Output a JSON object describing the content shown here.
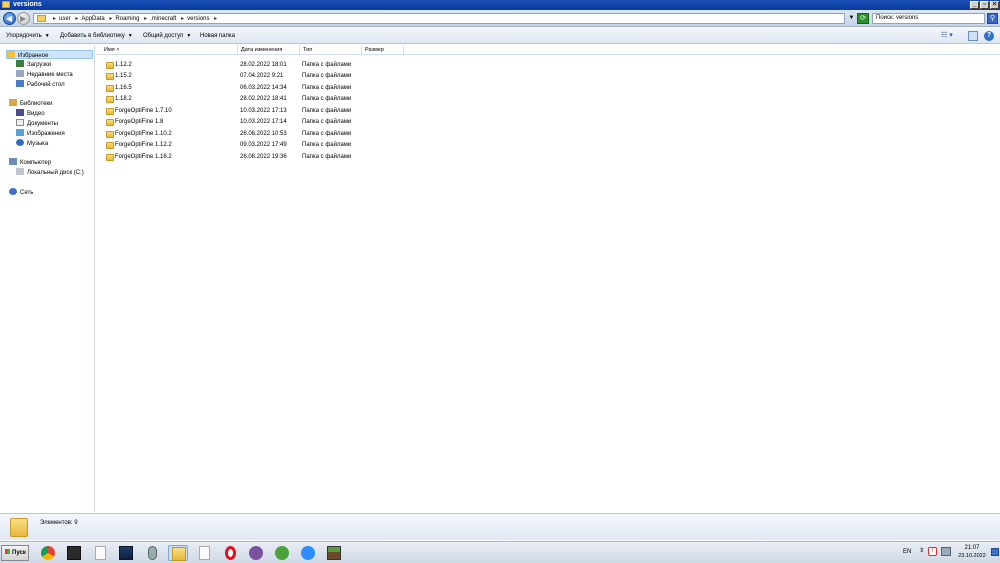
{
  "window": {
    "title": "versions",
    "minimize": "_",
    "maximize": "▫",
    "close": "✕"
  },
  "address": {
    "crumbs": [
      "user",
      "AppData",
      "Roaming",
      ".minecraft",
      "versions"
    ],
    "search_placeholder": "Поиск: versions"
  },
  "toolbar": {
    "organize": "Упорядочить",
    "add_to_library": "Добавить в библиотеку",
    "share": "Общий доступ",
    "new_folder": "Новая папка"
  },
  "nav": {
    "favorites": "Избранное",
    "downloads": "Загрузки",
    "recent": "Недавние места",
    "desktop": "Рабочий стол",
    "libraries": "Библиотеки",
    "video": "Видео",
    "documents": "Документы",
    "images": "Изображения",
    "music": "Музыка",
    "computer": "Компьютер",
    "local_disk": "Локальный диск (C:)",
    "network": "Сеть"
  },
  "columns": {
    "name": "Имя",
    "date": "Дата изменения",
    "type": "Тип",
    "size": "Размер"
  },
  "files": [
    {
      "name": "1.12.2",
      "date": "28.02.2022 18:01",
      "type": "Папка с файлами"
    },
    {
      "name": "1.15.2",
      "date": "07.04.2022 9:21",
      "type": "Папка с файлами"
    },
    {
      "name": "1.16.5",
      "date": "06.03.2022 14:34",
      "type": "Папка с файлами"
    },
    {
      "name": "1.18.2",
      "date": "28.02.2022 18:41",
      "type": "Папка с файлами"
    },
    {
      "name": "ForgeOptiFine 1.7.10",
      "date": "10.03.2022 17:13",
      "type": "Папка с файлами"
    },
    {
      "name": "ForgeOptiFine 1.8",
      "date": "10.03.2022 17:14",
      "type": "Папка с файлами"
    },
    {
      "name": "ForgeOptiFine 1.10.2",
      "date": "26.08.2022 10:53",
      "type": "Папка с файлами"
    },
    {
      "name": "ForgeOptiFine 1.12.2",
      "date": "09.03.2022 17:49",
      "type": "Папка с файлами"
    },
    {
      "name": "ForgeOptiFine 1.16.2",
      "date": "26.08.2022 19:36",
      "type": "Папка с файлами"
    }
  ],
  "details": {
    "items_count": "Элементов: 9"
  },
  "taskbar": {
    "start": "Пуск",
    "lang": "EN",
    "time": "21:07",
    "date": "23.10.2022"
  }
}
